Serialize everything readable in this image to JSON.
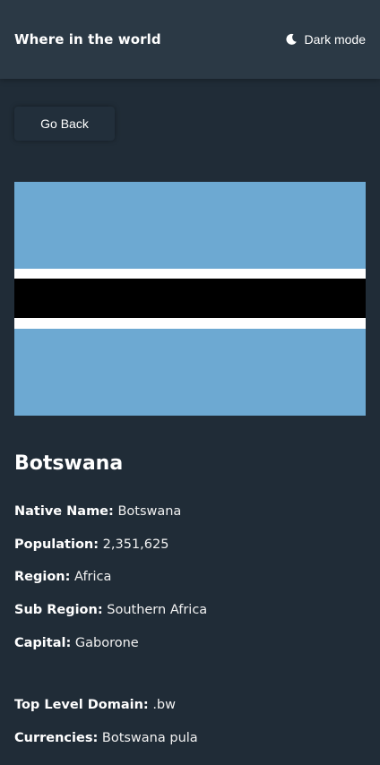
{
  "header": {
    "title": "Where in the world",
    "theme_toggle_label": "Dark mode",
    "theme_toggle_icon": "moon-icon"
  },
  "back_button": {
    "label": "Go Back"
  },
  "flag": {
    "colors": {
      "sky_blue": "#6da9d2",
      "white": "#ffffff",
      "black": "#000000"
    }
  },
  "country": {
    "name": "Botswana",
    "details": [
      {
        "label": "Native Name:",
        "value": "Botswana"
      },
      {
        "label": "Population:",
        "value": "2,351,625"
      },
      {
        "label": "Region:",
        "value": "Africa"
      },
      {
        "label": "Sub Region:",
        "value": "Southern Africa"
      },
      {
        "label": "Capital:",
        "value": "Gaborone"
      },
      {
        "label": "Top Level Domain:",
        "value": ".bw"
      },
      {
        "label": "Currencies:",
        "value": "Botswana pula"
      }
    ]
  },
  "colors": {
    "background": "#202c37",
    "header_background": "#2b3945",
    "text": "#ffffff"
  }
}
